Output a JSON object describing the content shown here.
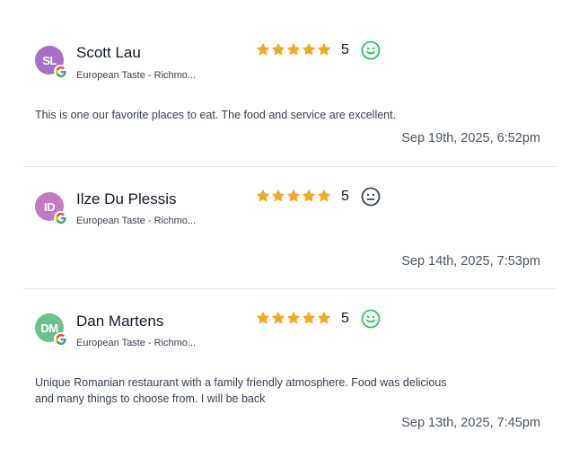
{
  "reviews": [
    {
      "initials": "SL",
      "avatar_color": "#a770c6",
      "name": "Scott Lau",
      "source": "European Taste - Richmo...",
      "rating": 5,
      "rating_label": "5",
      "sentiment": "happy-face-icon",
      "sentiment_color": "#22c55e",
      "text": "This is one our favorite places to eat. The food and service are excellent.",
      "date": "Sep 19th, 2025, 6:52pm"
    },
    {
      "initials": "ID",
      "avatar_color": "#c27bc0",
      "name": "Ilze Du Plessis",
      "source": "European Taste - Richmo...",
      "rating": 5,
      "rating_label": "5",
      "sentiment": "neutral-face-icon",
      "sentiment_color": "#374151",
      "text": "",
      "date": "Sep 14th, 2025, 7:53pm"
    },
    {
      "initials": "DM",
      "avatar_color": "#6cc08b",
      "name": "Dan Martens",
      "source": "European Taste - Richmo...",
      "rating": 5,
      "rating_label": "5",
      "sentiment": "happy-face-icon",
      "sentiment_color": "#22c55e",
      "text": "Unique Romanian restaurant with a family friendly atmosphere. Food was delicious and many things to choose from. I will be back",
      "date": "Sep 13th, 2025, 7:45pm"
    }
  ],
  "colors": {
    "star": "#f5a623",
    "google_blue": "#4285f4",
    "google_red": "#ea4335",
    "google_yellow": "#fbbc05",
    "google_green": "#34a853"
  }
}
